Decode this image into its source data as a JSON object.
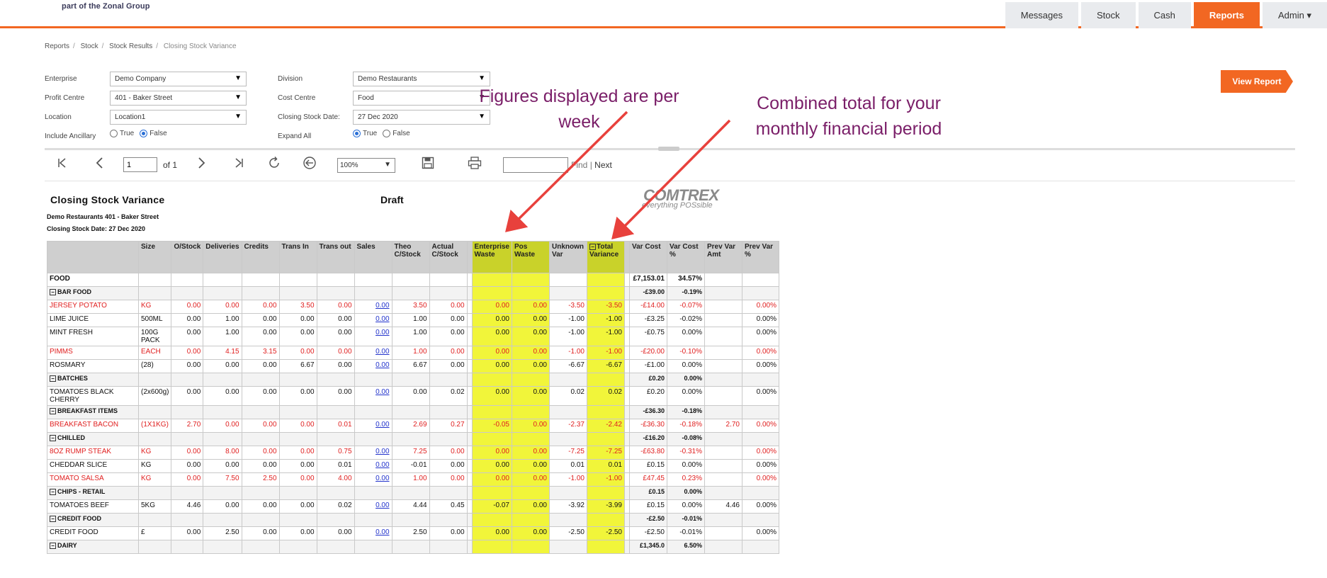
{
  "brand": {
    "text": "part of the Zonal Group"
  },
  "nav": {
    "tabs": [
      "Messages",
      "Stock",
      "Cash",
      "Reports",
      "Admin ▾"
    ],
    "active": "Reports"
  },
  "breadcrumb": {
    "items": [
      "Reports",
      "Stock",
      "Stock Results"
    ],
    "current": "Closing Stock Variance"
  },
  "filters": {
    "enterprise_label": "Enterprise",
    "enterprise_value": "Demo Company",
    "profit_centre_label": "Profit Centre",
    "profit_centre_value": "401 - Baker Street",
    "location_label": "Location",
    "location_value": "Location1",
    "include_ancillary_label": "Include Ancillary",
    "division_label": "Division",
    "division_value": "Demo Restaurants",
    "cost_centre_label": "Cost Centre",
    "cost_centre_value": "Food",
    "closing_stock_date_label": "Closing Stock Date:",
    "closing_stock_date_value": "27 Dec 2020",
    "expand_all_label": "Expand All",
    "true_label": "True",
    "false_label": "False",
    "include_ancillary_selected": "False",
    "expand_all_selected": "True"
  },
  "view_report": {
    "label": "View Report"
  },
  "toolbar": {
    "page_value": "1",
    "of_pages": "of 1",
    "zoom_value": "100%",
    "find_label": "Find",
    "find_sep": "|",
    "next_label": "Next",
    "icons": [
      "first-page-icon",
      "prev-page-icon",
      "next-page-icon",
      "last-page-icon",
      "refresh-icon",
      "back-icon",
      "save-icon",
      "print-icon"
    ]
  },
  "report": {
    "title": "Closing Stock Variance",
    "status": "Draft",
    "subtitle1": "Demo Restaurants 401 - Baker Street",
    "subtitle2": "Closing Stock Date: 27 Dec 2020",
    "logo_big": "COMTREX",
    "logo_small": "everything POSsible"
  },
  "table": {
    "headers": [
      "",
      "Size",
      "O/Stock",
      "Deliveries",
      "Credits",
      "Trans In",
      "Trans out",
      "Sales",
      "Theo C/Stock",
      "Actual C/Stock",
      "",
      "Enterprise Waste",
      "Pos Waste",
      "Unknown Var",
      "Total Variance",
      "",
      "Var Cost",
      "Var Cost %",
      "Prev Var Amt",
      "Prev Var %"
    ],
    "rows": [
      {
        "type": "cat",
        "cells": [
          "FOOD",
          "",
          "",
          "",
          "",
          "",
          "",
          "",
          "",
          "",
          "",
          "",
          "",
          "",
          "",
          "",
          "£7,153.01",
          "34.57%",
          "",
          ""
        ]
      },
      {
        "type": "group",
        "cells": [
          "BAR FOOD",
          "",
          "",
          "",
          "",
          "",
          "",
          "",
          "",
          "",
          "",
          "",
          "",
          "",
          "",
          "",
          "-£39.00",
          "-0.19%",
          "",
          ""
        ]
      },
      {
        "type": "red",
        "cells": [
          "JERSEY POTATO",
          "KG",
          "0.00",
          "0.00",
          "0.00",
          "3.50",
          "0.00",
          "0.00",
          "3.50",
          "0.00",
          "",
          "0.00",
          "0.00",
          "-3.50",
          "-3.50",
          "",
          "-£14.00",
          "-0.07%",
          "",
          "0.00%"
        ]
      },
      {
        "type": "item",
        "cells": [
          "LIME JUICE",
          "500ML",
          "0.00",
          "1.00",
          "0.00",
          "0.00",
          "0.00",
          "0.00",
          "1.00",
          "0.00",
          "",
          "0.00",
          "0.00",
          "-1.00",
          "-1.00",
          "",
          "-£3.25",
          "-0.02%",
          "",
          "0.00%"
        ]
      },
      {
        "type": "item",
        "cells": [
          "MINT FRESH",
          "100G PACK",
          "0.00",
          "1.00",
          "0.00",
          "0.00",
          "0.00",
          "0.00",
          "1.00",
          "0.00",
          "",
          "0.00",
          "0.00",
          "-1.00",
          "-1.00",
          "",
          "-£0.75",
          "0.00%",
          "",
          "0.00%"
        ]
      },
      {
        "type": "red",
        "cells": [
          "PIMMS",
          "EACH",
          "0.00",
          "4.15",
          "3.15",
          "0.00",
          "0.00",
          "0.00",
          "1.00",
          "0.00",
          "",
          "0.00",
          "0.00",
          "-1.00",
          "-1.00",
          "",
          "-£20.00",
          "-0.10%",
          "",
          "0.00%"
        ]
      },
      {
        "type": "item",
        "cells": [
          "ROSMARY",
          "(28)",
          "0.00",
          "0.00",
          "0.00",
          "6.67",
          "0.00",
          "0.00",
          "6.67",
          "0.00",
          "",
          "0.00",
          "0.00",
          "-6.67",
          "-6.67",
          "",
          "-£1.00",
          "0.00%",
          "",
          "0.00%"
        ]
      },
      {
        "type": "group",
        "cells": [
          "BATCHES",
          "",
          "",
          "",
          "",
          "",
          "",
          "",
          "",
          "",
          "",
          "",
          "",
          "",
          "",
          "",
          "£0.20",
          "0.00%",
          "",
          ""
        ]
      },
      {
        "type": "item",
        "cells": [
          "TOMATOES BLACK CHERRY",
          "(2x600g)",
          "0.00",
          "0.00",
          "0.00",
          "0.00",
          "0.00",
          "0.00",
          "0.00",
          "0.02",
          "",
          "0.00",
          "0.00",
          "0.02",
          "0.02",
          "",
          "£0.20",
          "0.00%",
          "",
          "0.00%"
        ]
      },
      {
        "type": "group",
        "cells": [
          "BREAKFAST ITEMS",
          "",
          "",
          "",
          "",
          "",
          "",
          "",
          "",
          "",
          "",
          "",
          "",
          "",
          "",
          "",
          "-£36.30",
          "-0.18%",
          "",
          ""
        ]
      },
      {
        "type": "red",
        "cells": [
          "BREAKFAST BACON",
          "(1X1KG)",
          "2.70",
          "0.00",
          "0.00",
          "0.00",
          "0.01",
          "0.00",
          "2.69",
          "0.27",
          "",
          "-0.05",
          "0.00",
          "-2.37",
          "-2.42",
          "",
          "-£36.30",
          "-0.18%",
          "2.70",
          "0.00%"
        ]
      },
      {
        "type": "group",
        "cells": [
          "CHILLED",
          "",
          "",
          "",
          "",
          "",
          "",
          "",
          "",
          "",
          "",
          "",
          "",
          "",
          "",
          "",
          "-£16.20",
          "-0.08%",
          "",
          ""
        ]
      },
      {
        "type": "red",
        "cells": [
          "8OZ RUMP STEAK",
          "KG",
          "0.00",
          "8.00",
          "0.00",
          "0.00",
          "0.75",
          "0.00",
          "7.25",
          "0.00",
          "",
          "0.00",
          "0.00",
          "-7.25",
          "-7.25",
          "",
          "-£63.80",
          "-0.31%",
          "",
          "0.00%"
        ]
      },
      {
        "type": "item",
        "cells": [
          "CHEDDAR SLICE",
          "KG",
          "0.00",
          "0.00",
          "0.00",
          "0.00",
          "0.01",
          "0.00",
          "-0.01",
          "0.00",
          "",
          "0.00",
          "0.00",
          "0.01",
          "0.01",
          "",
          "£0.15",
          "0.00%",
          "",
          "0.00%"
        ]
      },
      {
        "type": "red",
        "cells": [
          "TOMATO SALSA",
          "KG",
          "0.00",
          "7.50",
          "2.50",
          "0.00",
          "4.00",
          "0.00",
          "1.00",
          "0.00",
          "",
          "0.00",
          "0.00",
          "-1.00",
          "-1.00",
          "",
          "£47.45",
          "0.23%",
          "",
          "0.00%"
        ]
      },
      {
        "type": "group",
        "cells": [
          "CHIPS - RETAIL",
          "",
          "",
          "",
          "",
          "",
          "",
          "",
          "",
          "",
          "",
          "",
          "",
          "",
          "",
          "",
          "£0.15",
          "0.00%",
          "",
          ""
        ]
      },
      {
        "type": "item",
        "cells": [
          "TOMATOES BEEF",
          "5KG",
          "4.46",
          "0.00",
          "0.00",
          "0.00",
          "0.02",
          "0.00",
          "4.44",
          "0.45",
          "",
          "-0.07",
          "0.00",
          "-3.92",
          "-3.99",
          "",
          "£0.15",
          "0.00%",
          "4.46",
          "0.00%"
        ]
      },
      {
        "type": "group",
        "cells": [
          "CREDIT FOOD",
          "",
          "",
          "",
          "",
          "",
          "",
          "",
          "",
          "",
          "",
          "",
          "",
          "",
          "",
          "",
          "-£2.50",
          "-0.01%",
          "",
          ""
        ]
      },
      {
        "type": "item",
        "cells": [
          "CREDIT FOOD",
          "£",
          "0.00",
          "2.50",
          "0.00",
          "0.00",
          "0.00",
          "0.00",
          "2.50",
          "0.00",
          "",
          "0.00",
          "0.00",
          "-2.50",
          "-2.50",
          "",
          "-£2.50",
          "-0.01%",
          "",
          "0.00%"
        ]
      },
      {
        "type": "group",
        "cells": [
          "DAIRY",
          "",
          "",
          "",
          "",
          "",
          "",
          "",
          "",
          "",
          "",
          "",
          "",
          "",
          "",
          "",
          "£1,345.0",
          "6.50%",
          "",
          ""
        ]
      }
    ]
  },
  "annotations": {
    "left": "Figures displayed are per week",
    "right": "Combined total for your monthly financial period"
  },
  "colors": {
    "accent": "#f26722",
    "highlight": "#f1f53a",
    "annotation": "#7a1e68",
    "arrow": "#e8413c",
    "negative": "#e02020"
  }
}
